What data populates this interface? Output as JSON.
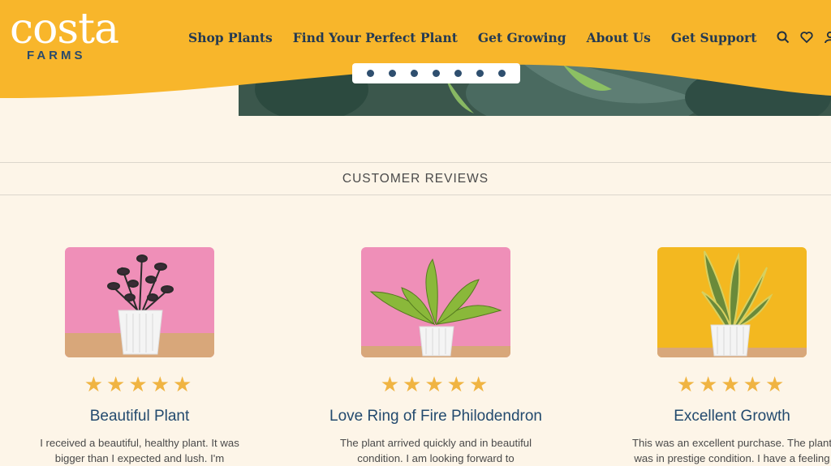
{
  "brand": {
    "logo_top": "costa",
    "logo_bottom": "FARMS",
    "primary_color": "#f8b62b",
    "nav_text_color": "#243a52",
    "background": "#fdf5e8"
  },
  "nav": {
    "items": [
      {
        "label": "Shop Plants"
      },
      {
        "label": "Find Your Perfect Plant"
      },
      {
        "label": "Get Growing"
      },
      {
        "label": "About Us"
      },
      {
        "label": "Get Support"
      }
    ],
    "icons": [
      "search-icon",
      "heart-icon",
      "account-icon"
    ]
  },
  "carousel": {
    "slide_count": 7
  },
  "reviews": {
    "title": "CUSTOMER REVIEWS",
    "star_color": "#f0b442",
    "items": [
      {
        "rating": 5,
        "stars": "★★★★★",
        "title": "Beautiful Plant",
        "text": "I received a beautiful, healthy plant. It was bigger than I expected and lush. I'm",
        "image_bg": "#ef8fb8",
        "plant": "zz-plant"
      },
      {
        "rating": 5,
        "stars": "★★★★★",
        "title": "Love Ring of Fire Philodendron",
        "text": "The plant arrived quickly and in beautiful condition. I am looking forward to",
        "image_bg": "#ef8fb8",
        "plant": "philodendron"
      },
      {
        "rating": 5,
        "stars": "★★★★★",
        "title": "Excellent Growth",
        "text": "This was an excellent purchase. The plant was in prestige condition. I have a feeling",
        "image_bg": "#f3b820",
        "plant": "snake-plant"
      }
    ]
  }
}
